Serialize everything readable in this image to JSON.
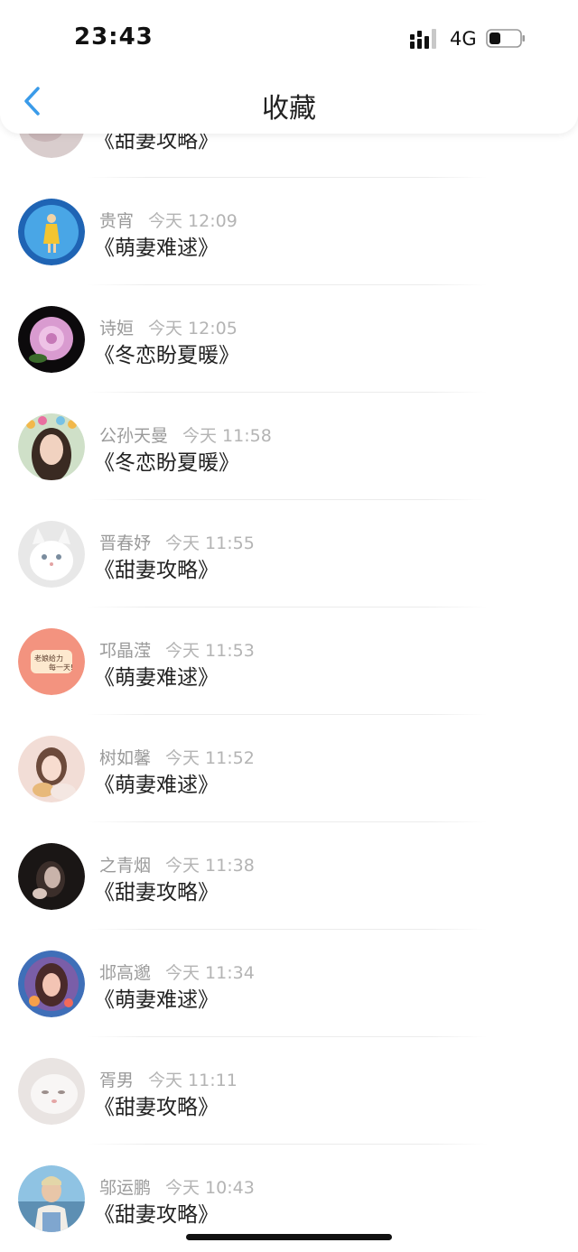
{
  "status_bar": {
    "time": "23:43",
    "network": "4G"
  },
  "nav": {
    "title": "收藏"
  },
  "items": [
    {
      "user": "",
      "time": "",
      "book": "《甜妻攻略》"
    },
    {
      "user": "贵宵",
      "time": "今天 12:09",
      "book": "《萌妻难逑》"
    },
    {
      "user": "诗姮",
      "time": "今天 12:05",
      "book": "《冬恋盼夏暖》"
    },
    {
      "user": "公孙天曼",
      "time": "今天 11:58",
      "book": "《冬恋盼夏暖》"
    },
    {
      "user": "晋春妤",
      "time": "今天 11:55",
      "book": "《甜妻攻略》"
    },
    {
      "user": "邛晶滢",
      "time": "今天 11:53",
      "book": "《萌妻难逑》"
    },
    {
      "user": "树如馨",
      "time": "今天 11:52",
      "book": "《萌妻难逑》"
    },
    {
      "user": "之青烟",
      "time": "今天 11:38",
      "book": "《甜妻攻略》"
    },
    {
      "user": "邶高邈",
      "time": "今天 11:34",
      "book": "《萌妻难逑》"
    },
    {
      "user": "胥男",
      "time": "今天 11:11",
      "book": "《甜妻攻略》"
    },
    {
      "user": "邬运鹏",
      "time": "今天 10:43",
      "book": "《甜妻攻略》"
    }
  ],
  "avatar_badge_text": [
    "老娘给力",
    "每一天!"
  ]
}
